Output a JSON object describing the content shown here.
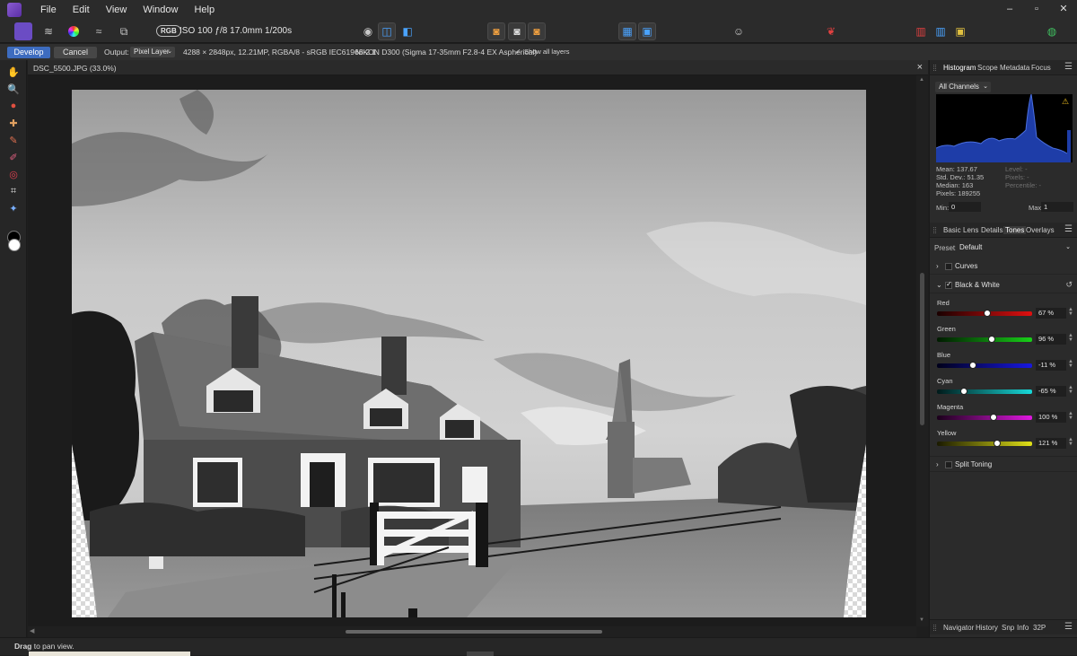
{
  "menubar": {
    "items": [
      "File",
      "Edit",
      "View",
      "Window",
      "Help"
    ],
    "window_controls": [
      "–",
      "▫",
      "✕"
    ]
  },
  "toolbar": {
    "color_mode": "RGB",
    "exif": "ISO 100 ƒ/8 17.0mm 1/200s"
  },
  "contextbar": {
    "develop_label": "Develop",
    "cancel_label": "Cancel",
    "output_label": "Output:",
    "output_value": "Pixel Layer",
    "image_info": "4288 × 2848px, 12.21MP, RGBA/8 - sRGB IEC61966-2.1",
    "camera": "NIKON D300 (Sigma 17-35mm F2.8-4 EX Aspherical)",
    "show_layers_label": "Show all layers"
  },
  "document": {
    "tab_name": "DSC_5500.JPG (33.0%)"
  },
  "panel": {
    "top_tabs": [
      "Histogram",
      "Scope",
      "Metadata",
      "Focus"
    ],
    "channels": "All Channels",
    "stats": {
      "mean": "Mean: 137.67",
      "std": "Std. Dev.: 51.35",
      "median": "Median: 163",
      "pixels": "Pixels: 189255",
      "level": "Level: -",
      "pixels_right": "Pixels: -",
      "percentile": "Percentile: -"
    },
    "min_label": "Min:",
    "min_value": "0",
    "max_label": "Max:",
    "max_value": "1",
    "adj_tabs": [
      "Basic",
      "Lens",
      "Details",
      "Tones",
      "Overlays"
    ],
    "preset_label": "Preset:",
    "preset_value": "Default",
    "sections": {
      "curves": "Curves",
      "bw": "Black & White",
      "split": "Split Toning"
    },
    "sliders": [
      {
        "label": "Red",
        "value": "67 %",
        "pos": 0.53,
        "from": "#1a0000",
        "to": "#e01010"
      },
      {
        "label": "Green",
        "value": "96 %",
        "pos": 0.58,
        "from": "#001a00",
        "to": "#18d018"
      },
      {
        "label": "Blue",
        "value": "-11 %",
        "pos": 0.38,
        "from": "#00001a",
        "to": "#1818e0"
      },
      {
        "label": "Cyan",
        "value": "-65 %",
        "pos": 0.28,
        "from": "#001a1a",
        "to": "#18d8d8"
      },
      {
        "label": "Magenta",
        "value": "100 %",
        "pos": 0.59,
        "from": "#1a001a",
        "to": "#e018e0"
      },
      {
        "label": "Yellow",
        "value": "121 %",
        "pos": 0.63,
        "from": "#1a1a00",
        "to": "#e0e018"
      }
    ],
    "bottom_tabs": [
      "Navigator",
      "History",
      "Snp",
      "Info",
      "32P"
    ]
  },
  "status": {
    "bold": "Drag",
    "text": " to pan view."
  },
  "colors": {
    "accent": "#3d6cbf",
    "histogram_fill": "#1e3da8"
  }
}
